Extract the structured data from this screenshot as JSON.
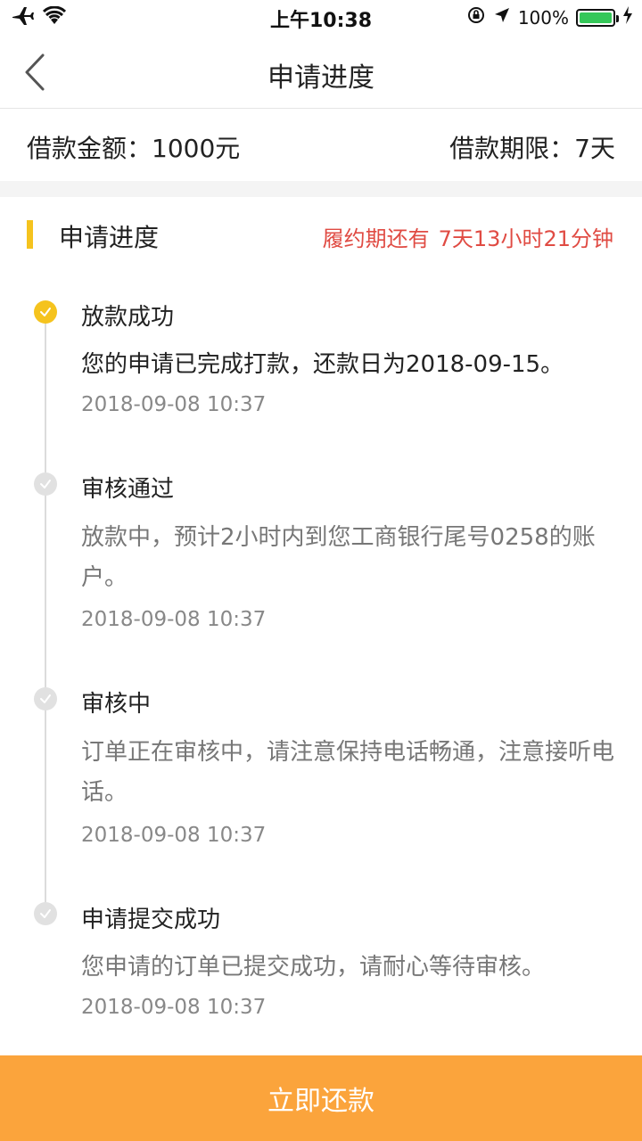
{
  "status_bar": {
    "time": "上午10:38",
    "battery": "100%",
    "battery_level": 1.0,
    "icons": [
      "airplane-icon",
      "wifi-icon",
      "rotation-lock-icon",
      "location-arrow-icon",
      "battery-icon",
      "charging-icon"
    ]
  },
  "nav": {
    "title": "申请进度",
    "back_icon": "chevron-left-icon"
  },
  "loan": {
    "amount_label": "借款金额：",
    "amount_value": "1000元",
    "term_label": "借款期限：",
    "term_value": "7天"
  },
  "section": {
    "title": "申请进度",
    "countdown_label": "履约期还有",
    "countdown_value": "7天13小时21分钟"
  },
  "timeline": [
    {
      "title": "放款成功",
      "desc": "您的申请已完成打款，还款日为2018-09-15。",
      "time": "2018-09-08 10:37",
      "status": "active"
    },
    {
      "title": "审核通过",
      "desc": "放款中，预计2小时内到您工商银行尾号0258的账户。",
      "time": "2018-09-08 10:37",
      "status": "done"
    },
    {
      "title": "审核中",
      "desc": "订单正在审核中，请注意保持电话畅通，注意接听电话。",
      "time": "2018-09-08 10:37",
      "status": "done"
    },
    {
      "title": "申请提交成功",
      "desc": "您申请的订单已提交成功，请耐心等待审核。",
      "time": "2018-09-08 10:37",
      "status": "done"
    }
  ],
  "repay_button": "立即还款",
  "colors": {
    "accent_yellow": "#f5c31e",
    "countdown_red": "#e04b43",
    "button_orange": "#fba43c",
    "battery_green": "#35c759"
  }
}
